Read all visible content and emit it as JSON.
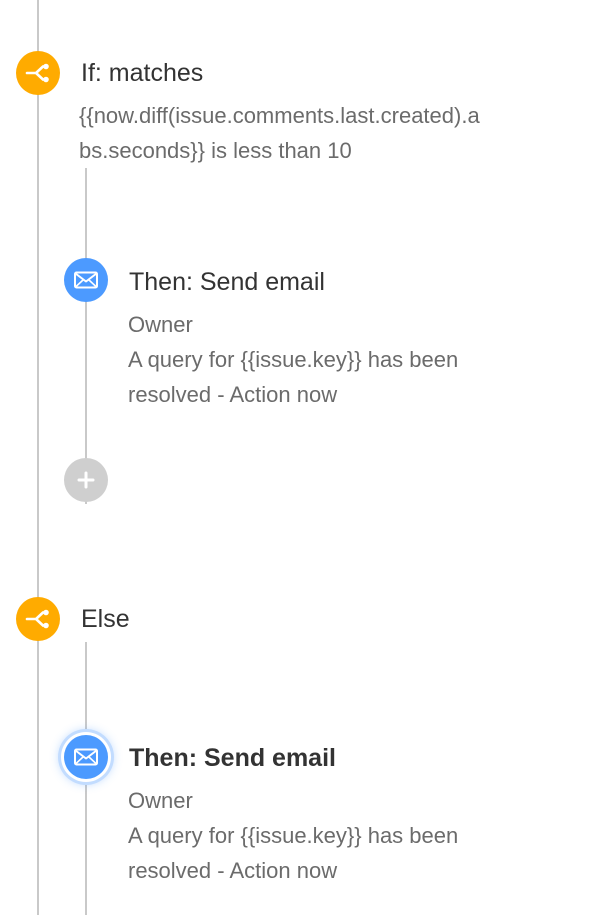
{
  "rule": {
    "if_block": {
      "icon": "branch-icon",
      "title": "If: matches",
      "condition": "{{now.diff(issue.comments.last.created).abs.seconds}} is less than 10",
      "condition_line1": "{{now.diff(issue.comments.last.created).a",
      "condition_line2": "bs.seconds}} is less than 10",
      "action": {
        "icon": "mail-icon",
        "title": "Then: Send email",
        "recipient": "Owner",
        "subject_line1": "A query for {{issue.key}} has been",
        "subject_line2": "resolved - Action now"
      },
      "add_action_icon": "plus-icon"
    },
    "else_block": {
      "icon": "branch-icon",
      "title": "Else",
      "action": {
        "icon": "mail-icon",
        "title": "Then: Send email",
        "recipient": "Owner",
        "subject_line1": "A query for {{issue.key}} has been",
        "subject_line2": "resolved - Action now",
        "selected": true
      }
    }
  },
  "colors": {
    "branch_node": "#ffab00",
    "email_node": "#4c9aff",
    "add_node": "#cfcfcf",
    "connector": "#c9c9c9",
    "title_text": "#333333",
    "detail_text": "#6b6b6b"
  }
}
